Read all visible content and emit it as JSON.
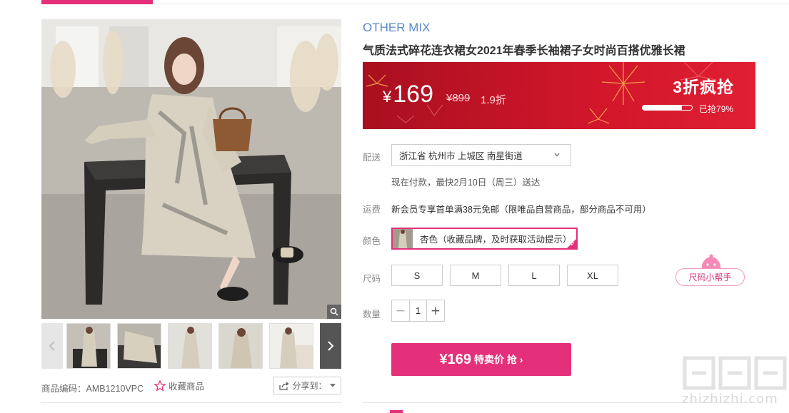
{
  "product": {
    "brand": "OTHER MIX",
    "title": "气质法式碎花连衣裙女2021年春季长袖裙子女时尚百搭优雅长裙",
    "sku_label": "商品编码：AMB1210VPC",
    "favorite_label": "收藏商品",
    "share_label": "分享到："
  },
  "gallery": {
    "thumb_count": 5,
    "prev_icon": "chevron-left-icon",
    "next_icon": "chevron-right-icon",
    "zoom_icon": "magnifier-icon"
  },
  "price": {
    "currency": "¥",
    "current": "169",
    "original": "¥899",
    "discount": "1.9折",
    "flash_label": "3折疯抢",
    "sold_fraction": 0.79,
    "sold_text": "已抢79%"
  },
  "delivery": {
    "label": "配送",
    "address": "浙江省 杭州市 上城区 南星街道",
    "eta": "现在付款，最快2月10日（周三）送达"
  },
  "shipping": {
    "label": "运费",
    "text": "新会员专享首单满38元免邮（限唯品自营商品，部分商品不可用）"
  },
  "color": {
    "label": "颜色",
    "selected": "杏色（收藏品牌，及时获取活动提示）"
  },
  "size": {
    "label": "尺码",
    "options": [
      "S",
      "M",
      "L",
      "XL"
    ],
    "helper_label": "尺码小帮手"
  },
  "quantity": {
    "label": "数量",
    "value": "1",
    "minus": "−",
    "plus": "+"
  },
  "buy": {
    "price": "¥169",
    "label": "特卖价 抢 ›"
  },
  "watermark": {
    "text": "zhizhizhi.com"
  },
  "colors": {
    "accent": "#e4307a",
    "brand_blue": "#5a88c8",
    "banner_red": "#d0162a"
  }
}
